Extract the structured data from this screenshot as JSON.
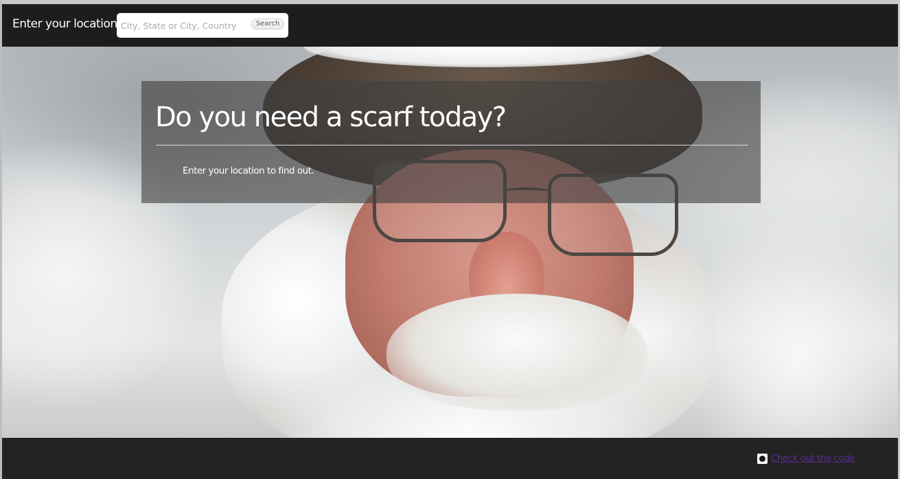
{
  "header": {
    "location_label": "Enter your location:",
    "search_placeholder": "City, State or City, Country",
    "search_value": "",
    "search_button_label": "Search"
  },
  "hero": {
    "title": "Do you need a scarf today?",
    "subtitle": "Enter your location to find out."
  },
  "footer": {
    "code_link_label": "Check out the code",
    "code_link_icon": "github-icon"
  },
  "colors": {
    "bar_background": "#111111",
    "panel_background": "#404040",
    "link": "#5b2c91",
    "text": "#ffffff"
  }
}
